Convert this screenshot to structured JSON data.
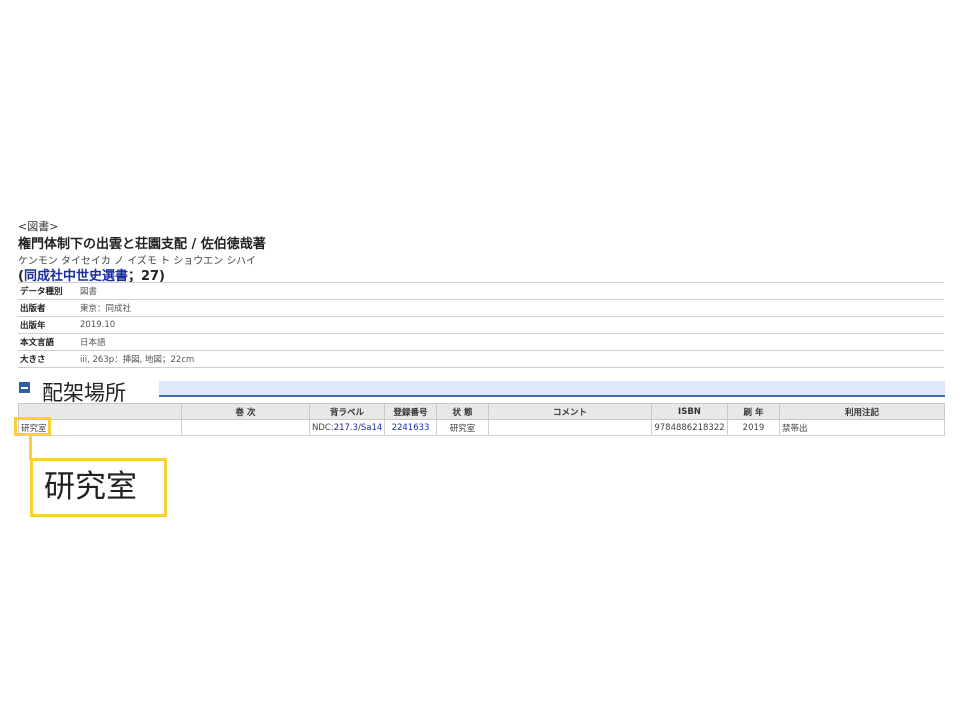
{
  "record": {
    "type_label": "<図書>",
    "title": "権門体制下の出雲と荘園支配 / 佐伯徳哉著",
    "reading": "ケンモン タイセイカ ノ イズモ ト ショウエン シハイ",
    "series_open": "(",
    "series_name": "同成社中世史選書",
    "series_suffix": "；27)"
  },
  "biblio": {
    "rows": [
      {
        "label": "データ種別",
        "value": "図書"
      },
      {
        "label": "出版者",
        "value": "東京：同成社"
      },
      {
        "label": "出版年",
        "value": "2019.10"
      },
      {
        "label": "本文言語",
        "value": "日本語"
      },
      {
        "label": "大きさ",
        "value": "iii, 263p：挿図, 地図；22cm"
      }
    ]
  },
  "holdings": {
    "callout_title": "配架場所",
    "headers": {
      "location": "",
      "volume": "巻 次",
      "call_label": "背ラベル",
      "reg_no": "登録番号",
      "status": "状 態",
      "comment": "コメント",
      "isbn": "ISBN",
      "print_year": "刷 年",
      "usage_note": "利用注記"
    },
    "row": {
      "location": "研究室",
      "volume": "",
      "call_prefix": "NDC:",
      "call_class": "217.3",
      "call_sep": "/",
      "call_author": "Sa14",
      "reg_no": "2241633",
      "status": "研究室",
      "comment": "",
      "isbn": "9784886218322",
      "print_year": "2019",
      "usage_note": "禁帯出"
    }
  },
  "callout": {
    "text": "研究室"
  },
  "colors": {
    "highlight": "#f7d136",
    "link": "#1a2ea0",
    "section_bar": "#dde9f8"
  }
}
